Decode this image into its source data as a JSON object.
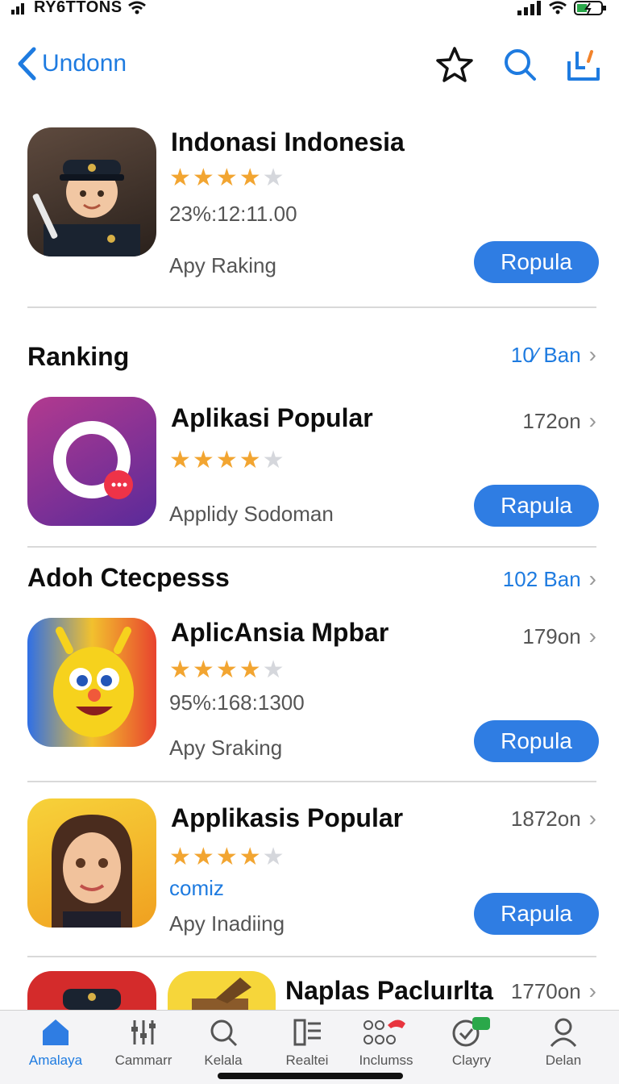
{
  "status_bar": {
    "carrier": "RY6TTONS"
  },
  "nav": {
    "back_label": "Undonn",
    "icons": [
      "star-icon",
      "search-icon",
      "download-icon"
    ]
  },
  "featured": {
    "title": "Indonasi Indonesia",
    "rating": 3.5,
    "meta": "23%:12:11.00",
    "subtitle": "Apy Raking",
    "button": "Ropula"
  },
  "sections": [
    {
      "title": "Ranking",
      "see_all": "10⁄ Ban",
      "items": [
        {
          "title": "Aplikasi Popular",
          "rating": 3.5,
          "subtitle": "Applidy Sodoman",
          "count": "172on",
          "button": "Rapula"
        }
      ]
    },
    {
      "title": "Adoh Ctecpesss",
      "see_all": "102 Ban",
      "items": [
        {
          "title": "AplicAnsia Mpbar",
          "rating": 4,
          "meta": "95%:168:1300",
          "subtitle": "Apy Sraking",
          "count": "179on",
          "button": "Ropula"
        },
        {
          "title": "Applikasis Popular",
          "rating": 4,
          "meta": "comiz",
          "subtitle": "Apy Inadiing",
          "count": "1872on",
          "button": "Rapula"
        },
        {
          "title": "Naplas Pacluırlta",
          "count": "1770on"
        }
      ]
    }
  ],
  "tabs": [
    {
      "label": "Amalaya",
      "icon": "home-icon",
      "active": true
    },
    {
      "label": "Cammarr",
      "icon": "tools-icon",
      "active": false
    },
    {
      "label": "Kelala",
      "icon": "search-icon",
      "active": false
    },
    {
      "label": "Realtei",
      "icon": "list-icon",
      "active": false
    },
    {
      "label": "Inclumss",
      "icon": "grid-icon",
      "active": false
    },
    {
      "label": "Clayry",
      "icon": "check-icon",
      "active": false
    },
    {
      "label": "Delan",
      "icon": "person-icon",
      "active": false
    }
  ],
  "colors": {
    "accent": "#2f7de3",
    "star": "#f2a531"
  }
}
